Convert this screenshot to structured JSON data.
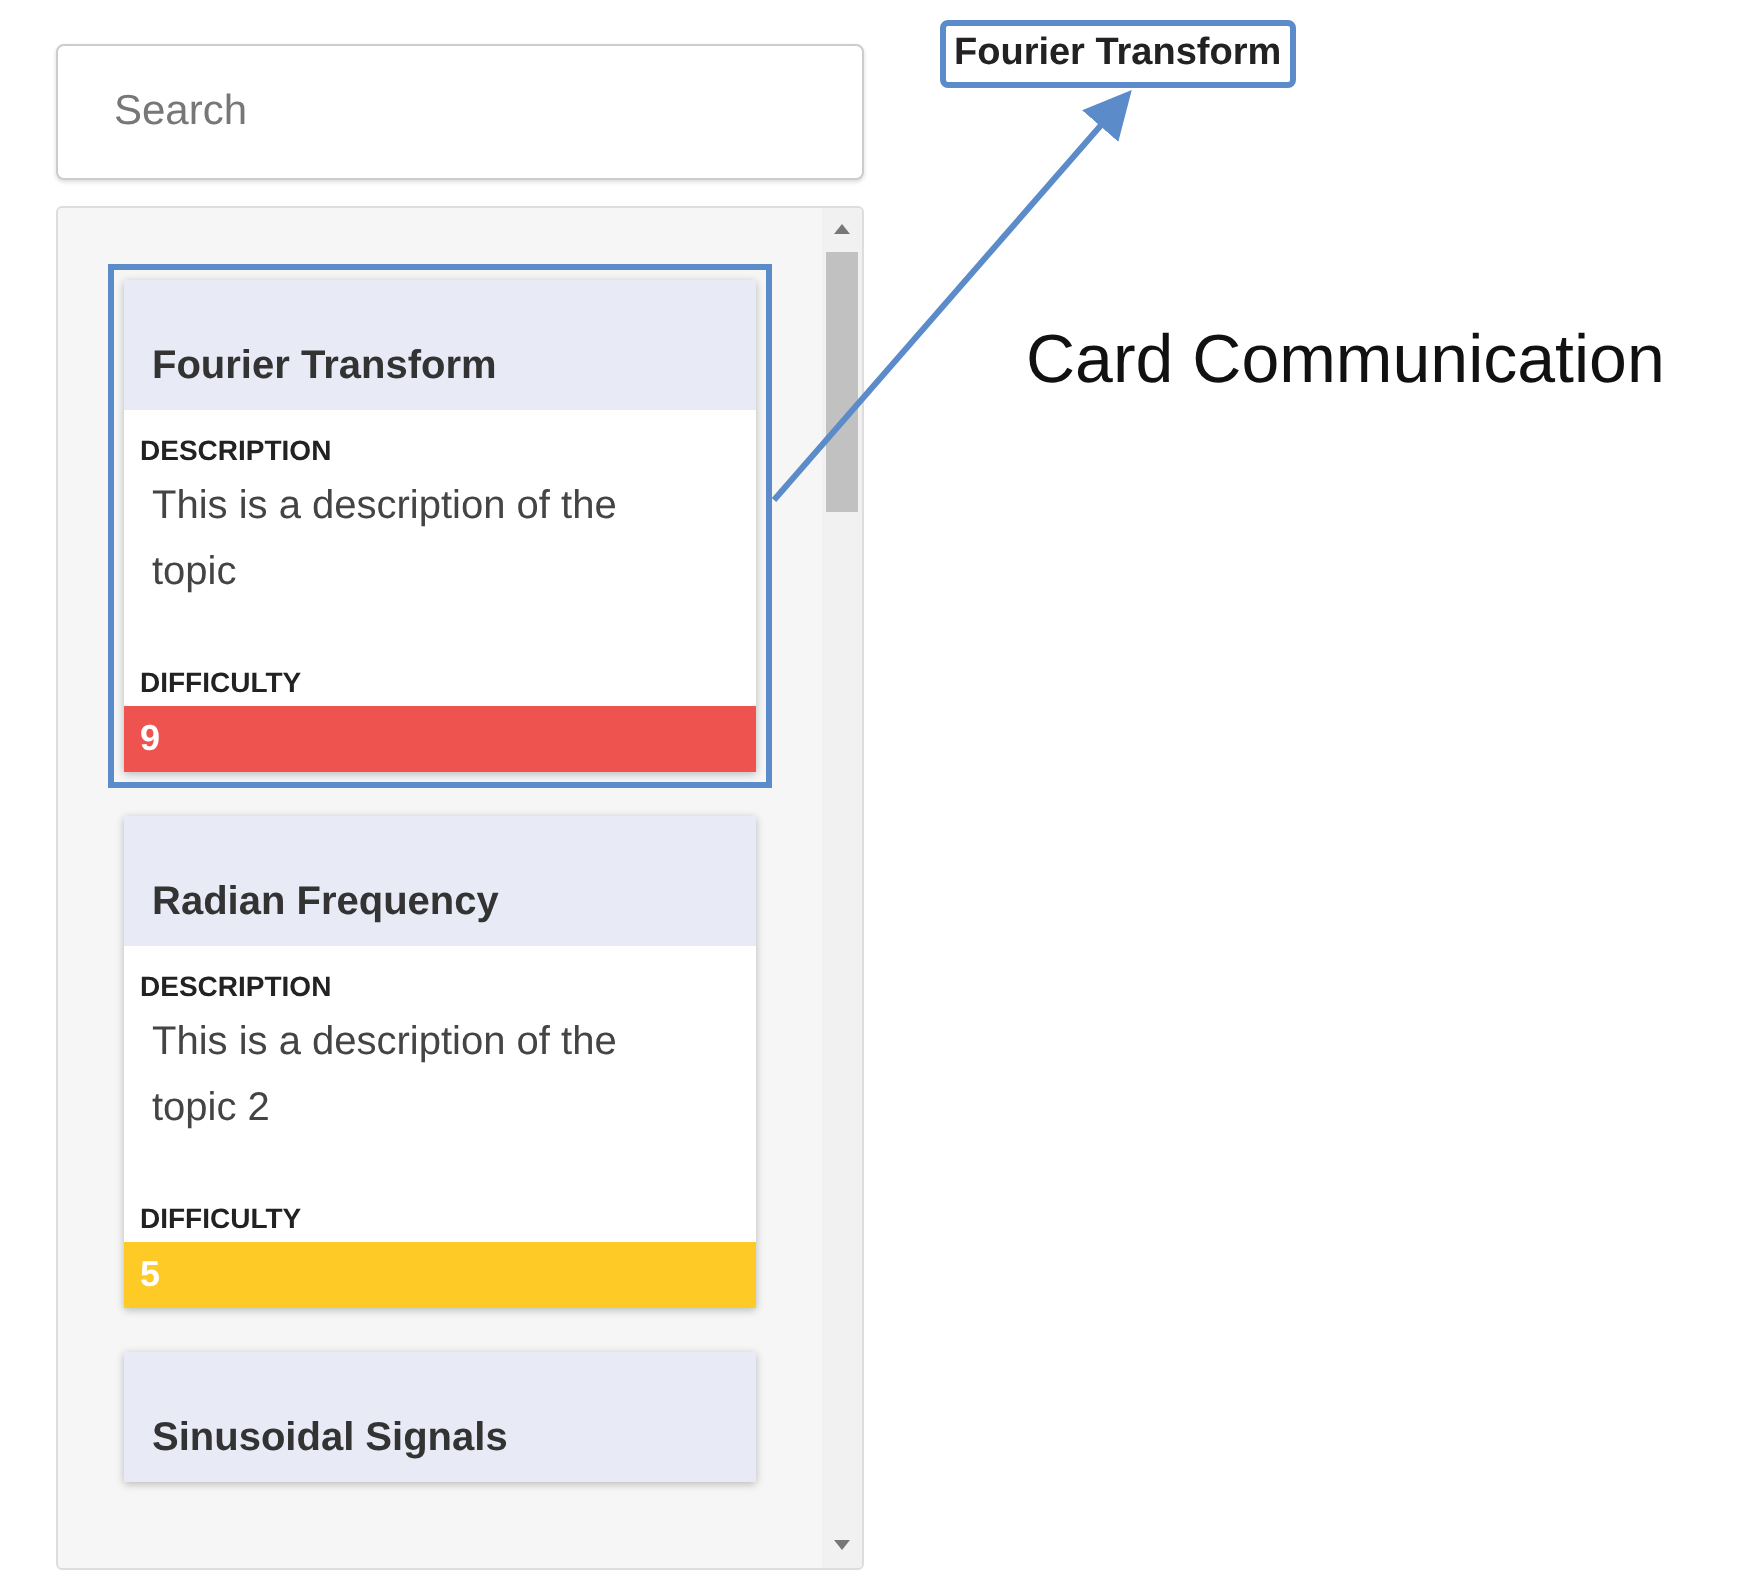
{
  "search": {
    "placeholder": "Search"
  },
  "cards": [
    {
      "title": "Fourier Transform",
      "description_label": "DESCRIPTION",
      "description": "This is a description of the topic",
      "difficulty_label": "DIFFICULTY",
      "difficulty": "9",
      "color": "#ef5350",
      "highlighted": true
    },
    {
      "title": "Radian Frequency",
      "description_label": "DESCRIPTION",
      "description": "This is a description of the topic 2",
      "difficulty_label": "DIFFICULTY",
      "difficulty": "5",
      "color": "#fdca26",
      "highlighted": false
    },
    {
      "title": "Sinusoidal Signals",
      "highlighted": false
    }
  ],
  "annotation": {
    "label": "Fourier Transform",
    "caption": "Card Communication"
  }
}
